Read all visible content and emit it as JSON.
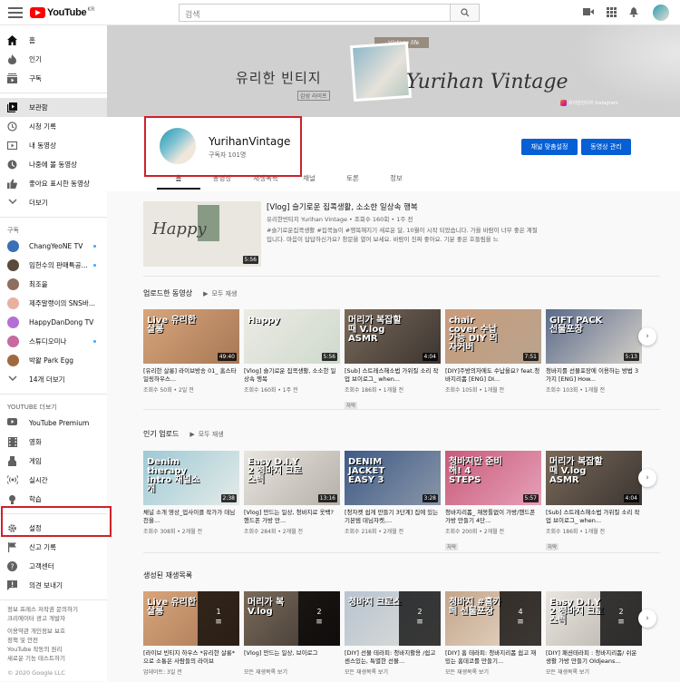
{
  "topbar": {
    "logo_text": "YouTube",
    "logo_country": "KR",
    "search_placeholder": "검색"
  },
  "sidebar": {
    "main": [
      {
        "label": "홈",
        "icon": "home-icon"
      },
      {
        "label": "인기",
        "icon": "trending-icon"
      },
      {
        "label": "구독",
        "icon": "subscriptions-icon"
      }
    ],
    "library": [
      {
        "label": "보관함",
        "icon": "library-icon",
        "active": true
      },
      {
        "label": "시청 기록",
        "icon": "history-icon"
      },
      {
        "label": "내 동영상",
        "icon": "my-videos-icon"
      },
      {
        "label": "나중에 볼 동영상",
        "icon": "watch-later-icon"
      },
      {
        "label": "좋아요 표시한 동영상",
        "icon": "liked-icon"
      },
      {
        "label": "더보기",
        "icon": "chevron-down-icon"
      }
    ],
    "subscriptions_header": "구독",
    "subscriptions": [
      {
        "label": "ChangYeoNE TV",
        "color": "#3b6fb6",
        "live": true
      },
      {
        "label": "임헌수의 판매특공...",
        "color": "#5a4a3a",
        "live": true
      },
      {
        "label": "최조을",
        "color": "#8e6e5e",
        "live": false
      },
      {
        "label": "제주말랭이의 SNS바...",
        "color": "#e8b0a0",
        "live": false
      },
      {
        "label": "HappyDanDong TV",
        "color": "#b46fd6",
        "live": false
      },
      {
        "label": "스튜디오미나",
        "color": "#c86aa0",
        "live": true
      },
      {
        "label": "박왈 Park Egg",
        "color": "#a06a40",
        "live": false
      },
      {
        "label": "14개 더보기",
        "color": "",
        "live": false
      }
    ],
    "more_header": "YOUTUBE 더보기",
    "more": [
      {
        "label": "YouTube Premium",
        "icon": "youtube-premium-icon"
      },
      {
        "label": "영화",
        "icon": "movies-icon"
      },
      {
        "label": "게임",
        "icon": "gaming-icon"
      },
      {
        "label": "실시간",
        "icon": "live-icon"
      },
      {
        "label": "학습",
        "icon": "learning-icon"
      }
    ],
    "settings": [
      {
        "label": "설정",
        "icon": "gear-icon"
      },
      {
        "label": "신고 기록",
        "icon": "flag-icon"
      },
      {
        "label": "고객센터",
        "icon": "help-icon"
      },
      {
        "label": "의견 보내기",
        "icon": "feedback-icon"
      }
    ],
    "footer_1": "정보 프레스 저작권 문의하기",
    "footer_2": "크리에이터 광고 개발자",
    "footer_3": "이용약관 개인정보 보호",
    "footer_4": "정책 및 안전",
    "footer_5": "YouTube 작동의 원리",
    "footer_6": "새로운 기능 테스트하기",
    "copyright": "© 2020 Google LLC"
  },
  "banner": {
    "title_korean": "유리한 빈티지",
    "subtitle_korean": "감성 라이프",
    "title_script": "Yurihan Vintage",
    "photo_label": "Vintage life",
    "social_label": "유리한빈티지 Instagram"
  },
  "channel": {
    "name": "YurihanVintage",
    "subscribers": "구독자 101명",
    "customize_button": "채널 맞춤설정",
    "manage_button": "동영상 관리",
    "tabs": [
      "홈",
      "동영상",
      "재생목록",
      "채널",
      "토론",
      "정보"
    ]
  },
  "featured": {
    "thumb_text": "Happy",
    "duration": "5:56",
    "title": "[Vlog] 슬기로운 집콕생활, 소소한 일상속 행복",
    "meta": "유리한빈티지 Yurihan Vintage • 조회수 160회 • 1주 전",
    "description": "#슬기로운집콕생활 #집콕놀이 #행복해지기 새로운 달, 10월이 시작 되었습니다. 가을 바람이 너무 좋은 계절입니다. 마음이 답답하신가요? 창문을 열어 보세요. 바람이 진짜 좋아요. 기분 좋은 호들림을 느"
  },
  "shelves": [
    {
      "title": "업로드한 동영상",
      "play_all": "모두 재생",
      "items": [
        {
          "thumb": "Live 유리한 살롱",
          "duration": "49:40",
          "title": "[유리한 살롱] 라이브방송 01_ 홈스타일링하우스...",
          "meta": "조회수 50회 • 2일 전",
          "caption": "",
          "bg": "linear-gradient(135deg,#d8a57b,#a77856)"
        },
        {
          "thumb": "Happy",
          "duration": "5:56",
          "title": "[Vlog] 슬기로운 집콕생활, 소소한 일상속 행복",
          "meta": "조회수 160회 • 1주 전",
          "caption": "",
          "bg": "linear-gradient(135deg,#ecebe5,#cfd9cc)"
        },
        {
          "thumb": "머리가 복잡할때 V.log ASMR",
          "duration": "4:04",
          "title": "[Sub] 스트레스해소법 가위질 소리 작업 브이로그_ when...",
          "meta": "조회수 186회 • 1개월 전",
          "caption": "자막",
          "bg": "linear-gradient(135deg,#7a6a5a,#3c3531)"
        },
        {
          "thumb": "chair cover 수납가능 DIY 의자커버",
          "duration": "7:51",
          "title": "[DIY]주방의자에도 수납을요? feat.청바지리폼 [ENG] DI...",
          "meta": "조회수 105회 • 1개월 전",
          "caption": "",
          "bg": "linear-gradient(135deg,#c99b7a,#b8a48e)"
        },
        {
          "thumb": "GIFT PACK 선물포장",
          "duration": "5:13",
          "title": "청바지를 선물포장에 이용하는 방법 3 가지 [ENG] How...",
          "meta": "조회수 103회 • 1개월 전",
          "caption": "",
          "bg": "linear-gradient(135deg,#5a6a8a,#d5d0c8)"
        }
      ]
    },
    {
      "title": "인기 업로드",
      "play_all": "모두 재생",
      "items": [
        {
          "thumb": "Denim therapy intro 채널소개",
          "duration": "2:38",
          "title": "채널 소개 영상_업사이클 작가가 데님천을...",
          "meta": "조회수 308회 • 2개월 전",
          "caption": "",
          "bg": "linear-gradient(135deg,#9dc9d6,#e5ebe7)"
        },
        {
          "thumb": "Easy D.I.Y 2 청바지 크로스백",
          "duration": "13:16",
          "title": "[Vlog] 만드는 일상, 청바지로 옷백? 핸드폰 가방 만...",
          "meta": "조회수 284회 • 2개월 전",
          "caption": "",
          "bg": "linear-gradient(135deg,#e9e6e0,#b5b0a8)"
        },
        {
          "thumb": "DENIM JACKET EASY 3",
          "duration": "3:28",
          "title": "[청자켓 쉽게 만들기 3단계] 집에 있는 기본템 데님자켓,...",
          "meta": "조회수 216회 • 2개월 전",
          "caption": "",
          "bg": "linear-gradient(135deg,#3d5a86,#8a96a8)"
        },
        {
          "thumb": "청바지만 준비해! 4 STEPS",
          "duration": "5:57",
          "title": "청바지리폼_ 재봉틀없이 가방/핸드폰 가방 만들기 4단...",
          "meta": "조회수 200회 • 2개월 전",
          "caption": "자막",
          "bg": "linear-gradient(135deg,#c85a7a,#e6a0b8)"
        },
        {
          "thumb": "머리가 복잡할때 V.log ASMR",
          "duration": "4:04",
          "title": "[Sub] 스트레스해소법 가위질 소리 작업 브이로그_ when...",
          "meta": "조회수 186회 • 1개월 전",
          "caption": "자막",
          "bg": "linear-gradient(135deg,#7a6a5a,#3c3531)"
        }
      ]
    },
    {
      "title": "생성된 재생목록",
      "play_all": "",
      "items": [
        {
          "thumb": "Live 유리한 살롱",
          "count": "1",
          "title": "[라이브 빈티지 하우스 *유리한 살롱*으로 소통은 사람들의 라이브",
          "meta": "업데이트: 3일 전",
          "caption": "",
          "bg": "linear-gradient(135deg,#d8a57b,#a77856)"
        },
        {
          "thumb": "머리가 복 V.log",
          "count": "2",
          "title": "[Vlog] 만드는 일상, 브이로그",
          "meta": "모든 재생목록 보기",
          "caption": "",
          "bg": "linear-gradient(135deg,#7a6a5a,#3c3531)"
        },
        {
          "thumb": "청바지 크로스",
          "count": "2",
          "title": "[DIY] 선물 테라피: 청바지활용 /쉽고 센스있는, 특별한 선물...",
          "meta": "모든 재생목록 보기",
          "caption": "",
          "bg": "linear-gradient(135deg,#b7c4d1,#e0ded8)"
        },
        {
          "thumb": "청바지 #홈카페 선물포장",
          "count": "4",
          "title": "[DIY] 홈 테라피: 청바지리폼 쉽고 재밌는 홈데코를 만들기...",
          "meta": "모든 재생목록 보기",
          "caption": "",
          "bg": "linear-gradient(135deg,#c4a58a,#e8dacb)"
        },
        {
          "thumb": "Easy D.I.Y 2 청바지 크로스백",
          "count": "2",
          "title": "[DIY] 패션테라피 : 청바지리폼/ 쉬운 생활 가방 만들기 Oldjeans...",
          "meta": "모든 재생목록 보기",
          "caption": "",
          "bg": "linear-gradient(135deg,#e9e6e0,#b5b0a8)"
        }
      ]
    }
  ],
  "colors": {
    "accent_blue": "#065fd4",
    "brand_red": "#ff0000",
    "highlight_box": "#cc2229"
  }
}
